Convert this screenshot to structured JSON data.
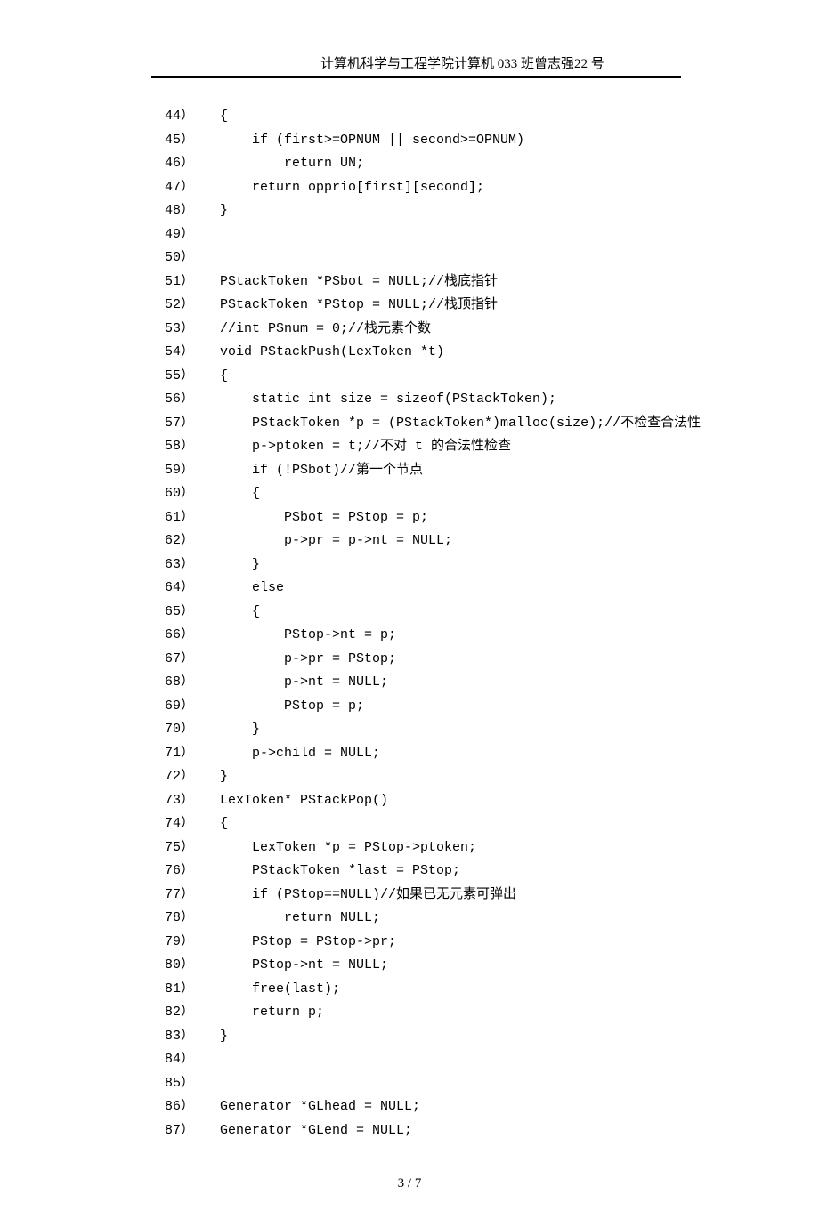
{
  "header": {
    "dept": "计算机科学与工程学院",
    "class": "计算机 033 班",
    "name": "曾志强",
    "num": "22 号"
  },
  "footer": "3 / 7",
  "code": [
    {
      "n": "44）",
      "t": "{"
    },
    {
      "n": "45）",
      "t": "    if (first>=OPNUM || second>=OPNUM)"
    },
    {
      "n": "46）",
      "t": "        return UN;"
    },
    {
      "n": "47）",
      "t": "    return opprio[first][second];"
    },
    {
      "n": "48）",
      "t": "}"
    },
    {
      "n": "49）",
      "t": ""
    },
    {
      "n": "50）",
      "t": ""
    },
    {
      "n": "51）",
      "t": "PStackToken *PSbot = NULL;//栈底指针"
    },
    {
      "n": "52）",
      "t": "PStackToken *PStop = NULL;//栈顶指针"
    },
    {
      "n": "53）",
      "t": "//int PSnum = 0;//栈元素个数"
    },
    {
      "n": "54）",
      "t": "void PStackPush(LexToken *t)"
    },
    {
      "n": "55）",
      "t": "{"
    },
    {
      "n": "56）",
      "t": "    static int size = sizeof(PStackToken);"
    },
    {
      "n": "57）",
      "t": "    PStackToken *p = (PStackToken*)malloc(size);//不检查合法性"
    },
    {
      "n": "58）",
      "t": "    p->ptoken = t;//不对 t 的合法性检查"
    },
    {
      "n": "59）",
      "t": "    if (!PSbot)//第一个节点"
    },
    {
      "n": "60）",
      "t": "    {"
    },
    {
      "n": "61）",
      "t": "        PSbot = PStop = p;"
    },
    {
      "n": "62）",
      "t": "        p->pr = p->nt = NULL;"
    },
    {
      "n": "63）",
      "t": "    }"
    },
    {
      "n": "64）",
      "t": "    else"
    },
    {
      "n": "65）",
      "t": "    {"
    },
    {
      "n": "66）",
      "t": "        PStop->nt = p;"
    },
    {
      "n": "67）",
      "t": "        p->pr = PStop;"
    },
    {
      "n": "68）",
      "t": "        p->nt = NULL;"
    },
    {
      "n": "69）",
      "t": "        PStop = p;"
    },
    {
      "n": "70）",
      "t": "    }"
    },
    {
      "n": "71）",
      "t": "    p->child = NULL;"
    },
    {
      "n": "72）",
      "t": "}"
    },
    {
      "n": "73）",
      "t": "LexToken* PStackPop()"
    },
    {
      "n": "74）",
      "t": "{"
    },
    {
      "n": "75）",
      "t": "    LexToken *p = PStop->ptoken;"
    },
    {
      "n": "76）",
      "t": "    PStackToken *last = PStop;"
    },
    {
      "n": "77）",
      "t": "    if (PStop==NULL)//如果已无元素可弹出"
    },
    {
      "n": "78）",
      "t": "        return NULL;"
    },
    {
      "n": "79）",
      "t": "    PStop = PStop->pr;"
    },
    {
      "n": "80）",
      "t": "    PStop->nt = NULL;"
    },
    {
      "n": "81）",
      "t": "    free(last);"
    },
    {
      "n": "82）",
      "t": "    return p;"
    },
    {
      "n": "83）",
      "t": "}"
    },
    {
      "n": "84）",
      "t": ""
    },
    {
      "n": "85）",
      "t": ""
    },
    {
      "n": "86）",
      "t": "Generator *GLhead = NULL;"
    },
    {
      "n": "87）",
      "t": "Generator *GLend = NULL;"
    }
  ]
}
